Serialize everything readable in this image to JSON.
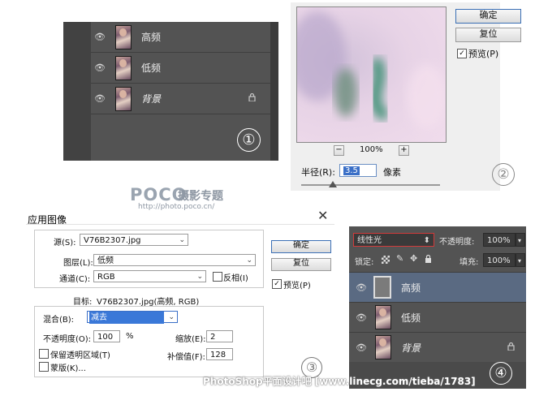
{
  "panel1": {
    "layers": [
      {
        "name": "高频",
        "visible": true,
        "locked": false
      },
      {
        "name": "低频",
        "visible": true,
        "locked": false
      },
      {
        "name": "背景",
        "visible": true,
        "locked": true
      }
    ],
    "marker": "①"
  },
  "panel2": {
    "ok_label": "确定",
    "reset_label": "复位",
    "preview_label": "预览(P)",
    "preview_checked": true,
    "zoom_out": "−",
    "zoom_level": "100%",
    "zoom_in": "+",
    "radius_label": "半径(R):",
    "radius_value": "3.5",
    "unit": "像素",
    "radius_slider_level": 0.23,
    "marker": "②"
  },
  "watermark": {
    "poco_logo": "POCO",
    "poco_title": "摄影专题",
    "poco_url": "http://photo.poco.cn/",
    "bottom_text": "PhotoShop平面设计吧 [www.linecg.com/tieba/1783]"
  },
  "panel3": {
    "title": "应用图像",
    "close_icon": "close-icon",
    "source_label": "源(S):",
    "source_value": "V76B2307.jpg",
    "layer_label": "图层(L):",
    "layer_value": "低频",
    "channel_label": "通道(C):",
    "channel_value": "RGB",
    "invert_label": "反相(I)",
    "invert_checked": false,
    "target_label": "目标:",
    "target_value": "V76B2307.jpg(高频, RGB)",
    "blend_label": "混合(B):",
    "blend_value": "减去",
    "opacity_label": "不透明度(O):",
    "opacity_value": "100",
    "opacity_unit": "%",
    "scale_label": "缩放(E):",
    "scale_value": "2",
    "offset_label": "补偿值(F):",
    "offset_value": "128",
    "preserve_label": "保留透明区域(T)",
    "preserve_checked": false,
    "mask_label": "蒙版(K)...",
    "mask_checked": false,
    "ok_label": "确定",
    "reset_label": "复位",
    "preview_label": "预览(P)",
    "preview_checked": true,
    "marker": "③"
  },
  "panel4": {
    "blend_mode": "线性光",
    "opacity_label": "不透明度:",
    "opacity_value": "100%",
    "lock_label": "锁定:",
    "fill_label": "填充:",
    "fill_value": "100%",
    "layers": [
      {
        "name": "高频",
        "visible": true,
        "locked": false,
        "selected": true
      },
      {
        "name": "低频",
        "visible": true,
        "locked": false,
        "selected": false
      },
      {
        "name": "背景",
        "visible": true,
        "locked": true,
        "selected": false
      }
    ],
    "marker": "④"
  }
}
